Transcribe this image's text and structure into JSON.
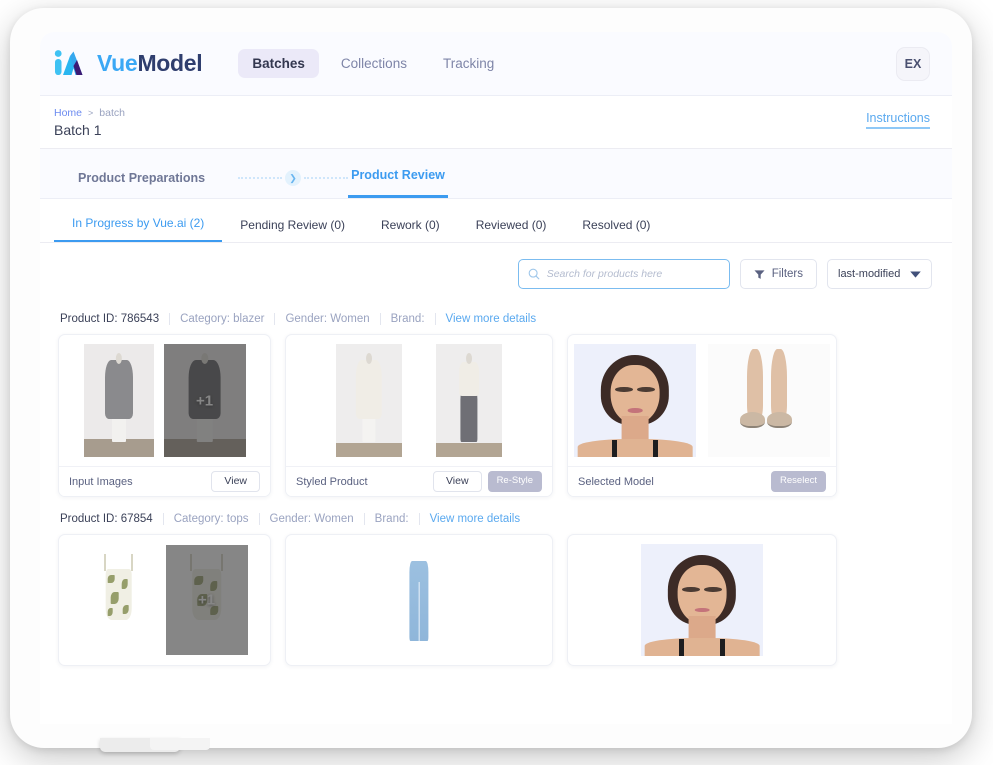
{
  "app": {
    "brand_first": "Vue",
    "brand_second": "Model",
    "logo_icon": "vuemodel-logo-icon"
  },
  "topnav": {
    "items": [
      {
        "label": "Batches",
        "active": true
      },
      {
        "label": "Collections",
        "active": false
      },
      {
        "label": "Tracking",
        "active": false
      }
    ],
    "avatar_initials": "EX"
  },
  "breadcrumb": {
    "home": "Home",
    "separator": ">",
    "current": "batch",
    "page_title": "Batch 1",
    "instructions_label": "Instructions"
  },
  "stepper": {
    "step_done": "Product Preparations",
    "step_current": "Product Review",
    "arrow_icon": "chevron-right-icon"
  },
  "subtabs": [
    {
      "label": "In Progress by Vue.ai (2)",
      "active": true
    },
    {
      "label": "Pending Review (0)",
      "active": false
    },
    {
      "label": "Rework (0)",
      "active": false
    },
    {
      "label": "Reviewed (0)",
      "active": false
    },
    {
      "label": "Resolved (0)",
      "active": false
    }
  ],
  "toolbar": {
    "search_placeholder": "Search for products here",
    "search_value": "",
    "search_icon": "search-icon",
    "filters_label": "Filters",
    "filters_icon": "filter-icon",
    "sort_value": "last-modified",
    "sort_caret_icon": "chevron-down-icon"
  },
  "products": [
    {
      "id_label": "Product ID: 786543",
      "category": "Category: blazer",
      "gender": "Gender: Women",
      "brand": "Brand:",
      "details_link": "View more details",
      "cards": [
        {
          "label": "Input Images",
          "actions": [
            {
              "label": "View",
              "style": "outline"
            }
          ],
          "badge": "+1"
        },
        {
          "label": "Styled Product",
          "actions": [
            {
              "label": "View",
              "style": "outline"
            },
            {
              "label": "Re-Style",
              "style": "muted"
            }
          ],
          "badge": ""
        },
        {
          "label": "Selected Model",
          "actions": [
            {
              "label": "Reselect",
              "style": "muted"
            }
          ],
          "badge": ""
        }
      ]
    },
    {
      "id_label": "Product ID: 67854",
      "category": "Category: tops",
      "gender": "Gender: Women",
      "brand": "Brand:",
      "details_link": "View more details",
      "cards": [
        {
          "label": "",
          "actions": [],
          "badge": "+1"
        },
        {
          "label": "",
          "actions": [],
          "badge": ""
        },
        {
          "label": "",
          "actions": [],
          "badge": ""
        }
      ]
    }
  ],
  "colors": {
    "accent_blue": "#3c9bf0",
    "link_blue": "#5aa9ef",
    "brand_dark": "#2f3e6e",
    "nav_pill": "#ebe9f8",
    "muted_button": "#b9bbd0",
    "text_dark": "#3b4158",
    "text_muted": "#9aa3c0"
  }
}
